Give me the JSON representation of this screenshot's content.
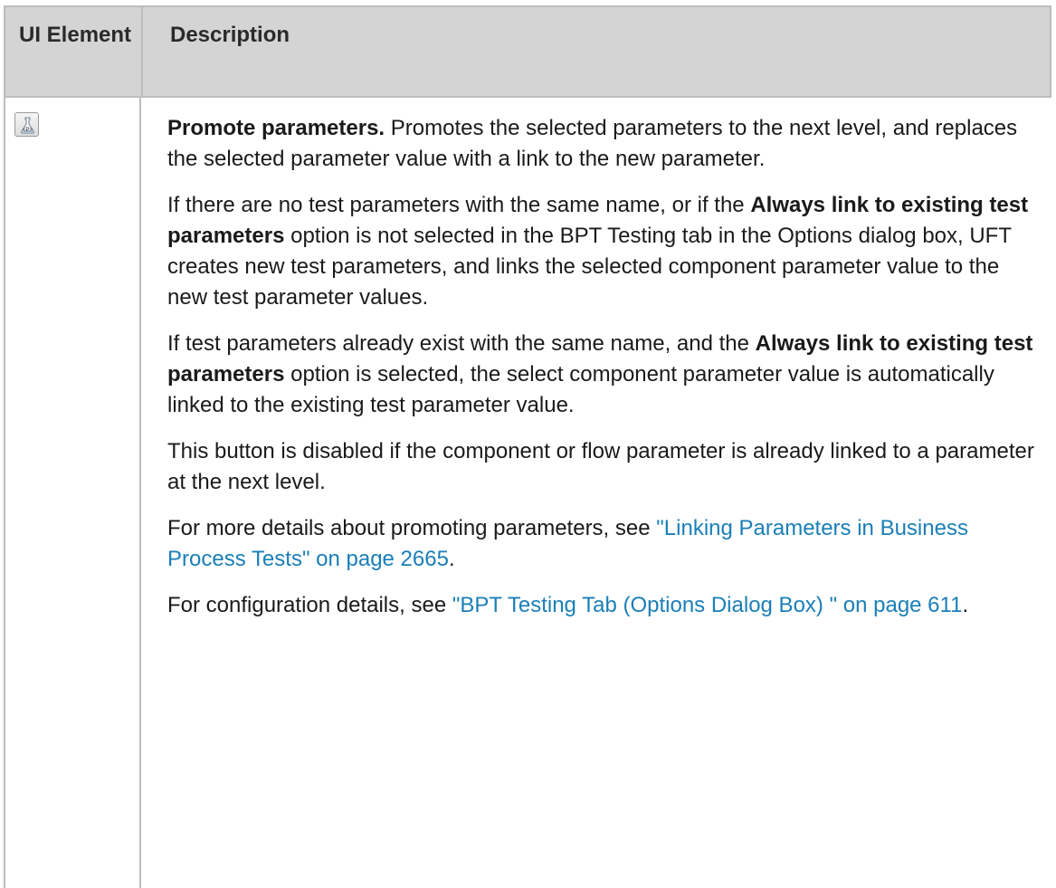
{
  "table": {
    "header": {
      "ui_element": "UI Element",
      "description": "Description"
    },
    "row": {
      "icon": "promote-parameters-icon",
      "title": "Promote parameters.",
      "p1_text": " Promotes the selected parameters to the next level, and replaces the selected parameter value with a link to the new parameter.",
      "p2_a": "If there are no test parameters with the same name, or if the ",
      "p2_bold": "Always link to existing test parameters",
      "p2_b": " option is not selected in the BPT Testing tab in the Options dialog box, UFT creates new test parameters, and links the selected component parameter value to the new test parameter values.",
      "p3_a": "If test parameters already exist with the same name, and the ",
      "p3_bold": "Always link to existing test parameters",
      "p3_b": " option is selected, the select component parameter value is automatically linked to the existing test parameter value.",
      "p4": "This button is disabled if the component or flow parameter is already linked to a parameter at the next level.",
      "p5_a": "For more details about promoting parameters, see ",
      "p5_link": "\"Linking Parameters in Business Process Tests\" on page 2665",
      "p5_b": ".",
      "p6_a": "For configuration details, see ",
      "p6_link": "\"BPT Testing Tab (Options Dialog Box) \" on page 611",
      "p6_b": "."
    }
  },
  "colors": {
    "header_bg": "#d4d4d4",
    "border": "#bdbdbd",
    "link": "#1a7fb8"
  }
}
